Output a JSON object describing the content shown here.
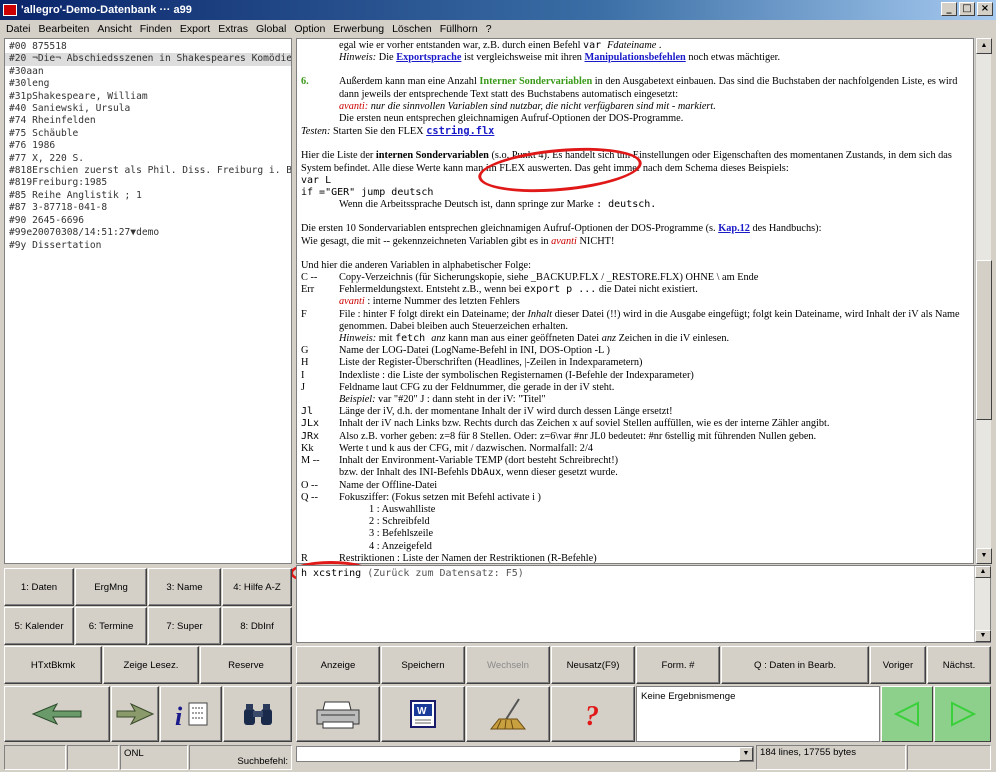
{
  "window": {
    "title": "'allegro'-Demo-Datenbank ··· a99",
    "min": "_",
    "max": "□",
    "close": "×"
  },
  "menu": [
    "Datei",
    "Bearbeiten",
    "Ansicht",
    "Finden",
    "Export",
    "Extras",
    "Global",
    "Option",
    "Erwerbung",
    "Löschen",
    "Füllhorn",
    "?"
  ],
  "record_lines": [
    "#00 875518",
    "#20 ¬Die¬ Abschiedsszenen in Shakespeares Komödien",
    "#30aan",
    "#30leng",
    "#31pShakespeare, William",
    "#40 Saniewski, Ursula",
    "#74 Rheinfelden",
    "#75 Schäuble",
    "#76 1986",
    "#77 X, 220 S.",
    "#818Erschien zuerst als Phil. Diss. Freiburg i. Br",
    "#819Freiburg:1985",
    "#85 Reihe Anglistik ; 1",
    "#87 3-87718-041-8",
    "#90 2645-6696",
    "#99e20070308/14:51:27▼demo",
    "#9y Dissertation"
  ],
  "doc": {
    "l1a": "egal wie er vorher entstanden war, z.B. durch einen Befehl ",
    "l1b": "var ",
    "l1c": "Fdateiname",
    "l1d": " .",
    "hinweis": "Hinweis:",
    "l2a": " Die ",
    "l2link1": "Exportsprache",
    "l2b": " ist vergleichsweise mit ihren ",
    "l2link2": "Manipulationsbefehlen",
    "l2c": " noch etwas mächtiger.",
    "p6num": "6.",
    "p6a": "Außerdem  kann man eine Anzahl ",
    "p6grn": "Interner Sondervariablen",
    "p6b": " in den Ausgabetext einbauen. Das sind die Buchstaben der nachfolgenden Liste, es wird dann jeweils der entsprechende Text statt des Buchstabens automatisch eingesetzt:",
    "p6avanti": "avanti:",
    "p6c": " nur die sinnvollen Variablen sind nutzbar,  die nicht verfügbaren sind mit  -  markiert.",
    "p6d": "Die ersten neun entsprechen gleichnamigen Aufruf-Optionen der DOS-Programme.",
    "testen": "Testen:",
    "testen_b": " Starten Sie den FLEX  ",
    "testen_flx": "cstring.flx",
    "intro_a": "Hier die Liste der ",
    "intro_b": "internen Sondervariablen",
    "intro_c": " (s.o. Punkt 4). Es handelt sich um Einstellungen oder Eigenschaften des momentanen Zustands, in dem sich das System befindet. Alle diese Werte kann  man im FLEX auswerten. Das geht immer nach dem Schema dieses Beispiels:",
    "code1": "var L",
    "code2": "if =\"GER\" jump deutsch",
    "code3a": "Wenn die Arbeitssprache Deutsch ist, dann springe zur Marke  ",
    "code3b": ": deutsch.",
    "p10a": "Die ersten 10 Sondervariablen entsprechen gleichnamigen Aufruf-Optionen der DOS-Programme (s.  ",
    "p10link": "Kap.12",
    "p10b": "  des Handbuchs):",
    "p10c": "Wie gesagt, die mit -- gekennzeichneten Variablen gibt es in ",
    "p10avanti": "avanti",
    "p10d": " NICHT!",
    "alpha": "Und hier die anderen Variablen in alphabetischer Folge:",
    "C_k": "C --",
    "C_v": "Copy-Verzeichnis (für Sicherungskopie, siehe _BACKUP.FLX / _RESTORE.FLX) OHNE \\ am Ende",
    "Err_k": "Err",
    "Err_v1": "Fehlermeldungstext. Entsteht z.B., wenn bei ",
    "Err_v2": "export p ...",
    "Err_v3": "  die Datei nicht existiert.",
    "Err_a": "avanti",
    "Err_a2": " : interne Nummer des letzten Fehlers",
    "F_k": "F",
    "F_v1": "File : hinter F folgt direkt ein Dateiname; der ",
    "F_inhalt": "Inhalt",
    "F_v2": " dieser Datei (!!) wird in die Ausgabe eingefügt; folgt kein Dateiname, wird Inhalt der iV als Name genommen. Dabei bleiben auch Steuerzeichen erhalten.",
    "F_hw": "Hinweis:",
    "F_hw2": "  mit ",
    "F_hw3": "fetch ",
    "F_hw4": "anz",
    "F_hw5": "  kann man aus einer geöffneten Datei ",
    "F_hw6": "anz",
    "F_hw7": " Zeichen in die iV einlesen.",
    "G_k": "G",
    "G_v": "Name der LOG-Datei (LogName-Befehl in INI, DOS-Option -L )",
    "H_k": "H",
    "H_v": "Liste der Register-Überschriften (Headlines, |-Zeilen in Indexparametern)",
    "I_k": "I",
    "I_v": "Indexliste : die Liste der symbolischen Registernamen (I-Befehle der Indexparameter)",
    "J_k": "J",
    "J_v": "Feldname laut CFG zu der Feldnummer, die gerade in der iV steht.",
    "J_b": "Beispiel:",
    "J_b2": " var \"#20\" J : dann steht in der iV: \"Titel\"",
    "Jl_k": "Jl",
    "Jl_v": "Länge der iV, d.h. der momentane Inhalt der iV wird durch dessen Länge ersetzt!",
    "JLx_k": "JLx",
    "JLx_v": "Inhalt der iV nach Links bzw. Rechts durch das Zeichen x auf soviel Stellen auffüllen, wie es der interne Zähler angibt.",
    "JRx_k": "JRx",
    "JRx_v": "Also z.B. vorher geben:  z=8  für 8 Stellen. Oder:  z=6\\var #nr JL0  bedeutet: #nr 6stellig mit führenden Nullen geben.",
    "Kk_k": "Kk",
    "Kk_v": "Werte t und k aus der CFG, mit / dazwischen. Normalfall: 2/4",
    "M_k": "M --",
    "M_v": "Inhalt der Environment-Variable TEMP (dort besteht Schreibrecht!)",
    "M_v2a": "bzw. der Inhalt des INI-Befehls ",
    "M_v2b": "DbAux",
    "M_v2c": ", wenn dieser gesetzt wurde.",
    "O_k": "O --",
    "O_v": "Name der Offline-Datei",
    "Q_k": "Q --",
    "Q_v": "Fokusziffer: (Fokus setzen mit Befehl activate i )",
    "Q1": "1 : Auswahlliste",
    "Q2": "2 : Schreibfeld",
    "Q3": "3 : Befehlszeile",
    "Q4": "4 : Anzeigefeld",
    "R_k": "R",
    "R_v": "Restriktionen : Liste der Namen der Restriktionen (R-Befehle)"
  },
  "command": {
    "text": "h xcstring",
    "hint": "  (Zurück zum Datensatz: F5)"
  },
  "left_buttons": {
    "r1": [
      "1: Daten",
      "ErgMng",
      "3: Name",
      "4: Hilfe A-Z"
    ],
    "r2": [
      "5: Kalender",
      "6: Termine",
      "7: Super",
      "8: DbInf"
    ],
    "r3": [
      "HTxtBkmk",
      "Zeige Lesez.",
      "Reserve"
    ]
  },
  "right_buttons": {
    "anzeige": "Anzeige",
    "speichern": "Speichern",
    "wechseln": "Wechseln",
    "neusatz": "Neusatz(F9)",
    "form": "Form. #",
    "daten": "Q : Daten in Bearb.",
    "voriger": "Voriger",
    "naechst": "Nächst."
  },
  "result_text": "Keine Ergebnismenge",
  "status": {
    "onl": "ONL",
    "suchbefehl": "Suchbefehl:",
    "lines": "184 lines, 17755 bytes"
  },
  "colors": {
    "accent_red": "#e01818",
    "green_text": "#3a9a1a",
    "link_blue": "#1a1ac8"
  }
}
